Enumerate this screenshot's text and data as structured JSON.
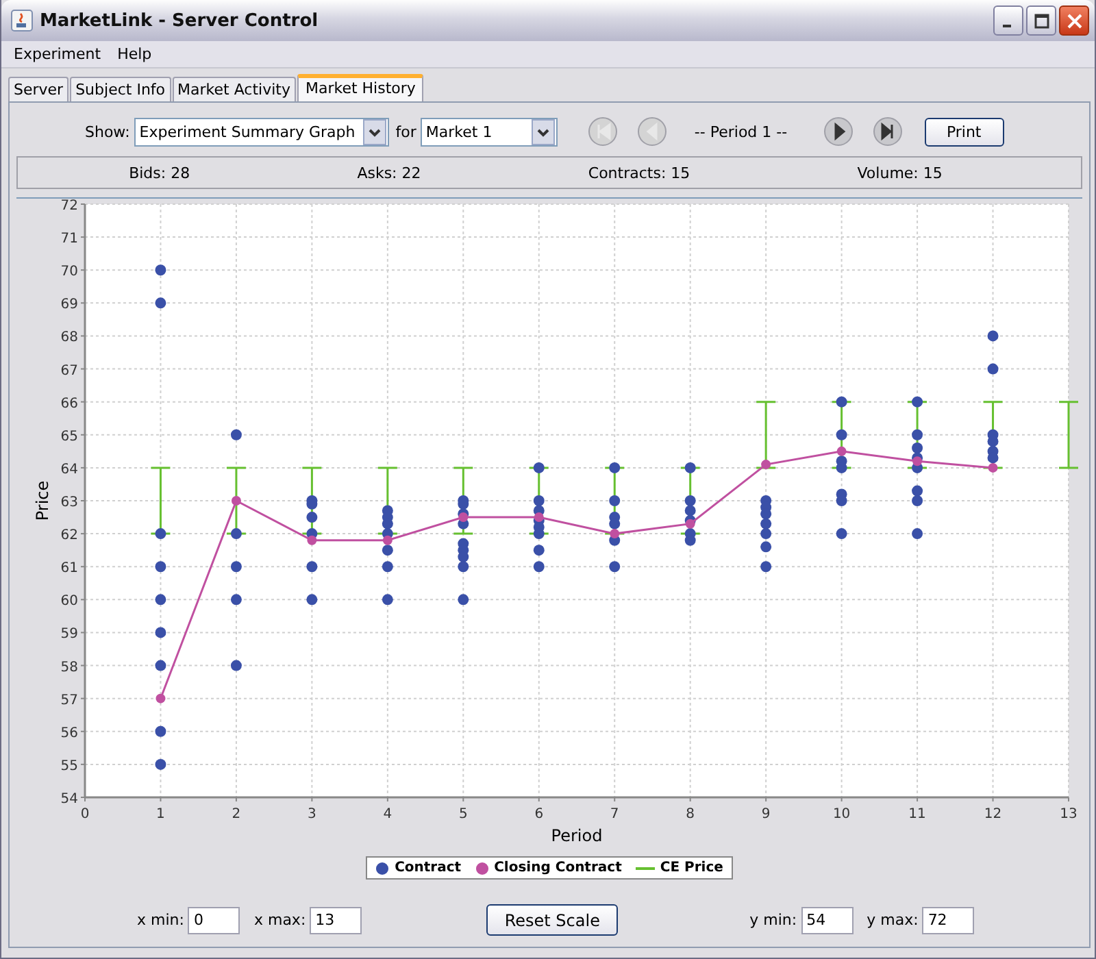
{
  "window": {
    "title": "MarketLink - Server Control"
  },
  "menu": [
    {
      "label": "Experiment"
    },
    {
      "label": "Help"
    }
  ],
  "tabs": [
    {
      "label": "Server",
      "selected": false
    },
    {
      "label": "Subject Info",
      "selected": false
    },
    {
      "label": "Market Activity",
      "selected": false
    },
    {
      "label": "Market History",
      "selected": true
    }
  ],
  "toolbar": {
    "show_label": "Show:",
    "show_select": "Experiment Summary Graph",
    "for_label": "for",
    "market_select": "Market 1",
    "nav_before": [
      {
        "kind": "first",
        "disabled": true
      },
      {
        "kind": "prev",
        "disabled": true
      }
    ],
    "period_label": "-- Period 1 --",
    "nav_after": [
      {
        "kind": "next",
        "disabled": false
      },
      {
        "kind": "last",
        "disabled": false
      }
    ],
    "print_button": {
      "label": "Print"
    }
  },
  "stats": [
    "Bids: 28",
    "Asks: 22",
    "Contracts: 15",
    "Volume: 15"
  ],
  "chart": {
    "chart_data": {
      "type": "scatter",
      "grid": true,
      "legend": "bottom",
      "xlabel": "Period",
      "ylabel": "Price",
      "xlim": [
        0,
        13
      ],
      "ylim": [
        54,
        72
      ],
      "xticks": [
        0,
        1,
        2,
        3,
        4,
        5,
        6,
        7,
        8,
        9,
        10,
        11,
        12,
        13
      ],
      "yticks": [
        54,
        55,
        56,
        57,
        58,
        59,
        60,
        61,
        62,
        63,
        64,
        65,
        66,
        67,
        68,
        69,
        70,
        71,
        72
      ],
      "series": [
        {
          "name": "Contract",
          "color": "#3a50a8",
          "marker": "circle",
          "x": [
            1,
            1,
            1,
            1,
            1,
            1,
            1,
            1,
            1,
            2,
            2,
            2,
            2,
            2,
            3,
            3,
            3,
            3,
            3,
            3,
            4,
            4,
            4,
            4,
            4,
            4,
            4,
            5,
            5,
            5,
            5,
            5,
            5,
            5,
            5,
            5,
            6,
            6,
            6,
            6,
            6,
            6,
            6,
            6,
            7,
            7,
            7,
            7,
            7,
            7,
            8,
            8,
            8,
            8,
            8,
            8,
            9,
            9,
            9,
            9,
            9,
            9,
            9,
            10,
            10,
            10,
            10,
            10,
            10,
            10,
            11,
            11,
            11,
            11,
            11,
            11,
            11,
            11,
            12,
            12,
            12,
            12,
            12,
            12
          ],
          "values": [
            70,
            69,
            62,
            61,
            60,
            59,
            58,
            56,
            55,
            65,
            62,
            61,
            60,
            58,
            63,
            62.9,
            62.5,
            62,
            61,
            60,
            62.7,
            62.5,
            62.3,
            62,
            61.5,
            61,
            60,
            63,
            62.9,
            62.6,
            62.3,
            61.7,
            61.5,
            61.3,
            61,
            60,
            64,
            63,
            62.7,
            62.4,
            62.2,
            62,
            61.5,
            61,
            64,
            63,
            62.5,
            62.3,
            61.8,
            61,
            64,
            63,
            62.7,
            62.4,
            62,
            61.8,
            63,
            62.8,
            62.6,
            62.3,
            62,
            61.6,
            61,
            66,
            65,
            64.2,
            64,
            63.2,
            63,
            62,
            66,
            65,
            64.6,
            64.3,
            64,
            63.3,
            63,
            62,
            68,
            67,
            65,
            64.8,
            64.5,
            64.3
          ]
        },
        {
          "name": "Closing Contract",
          "color": "#c050a0",
          "type": "line",
          "marker": "circle",
          "x": [
            1,
            2,
            3,
            4,
            5,
            6,
            7,
            8,
            9,
            10,
            11,
            12
          ],
          "values": [
            57,
            63,
            61.8,
            61.8,
            62.5,
            62.5,
            62,
            62.3,
            64.1,
            64.5,
            64.2,
            64
          ]
        },
        {
          "name": "CE Price",
          "color": "#66c030",
          "type": "line",
          "x": [
            1,
            1,
            null,
            2,
            2,
            null,
            3,
            3,
            null,
            4,
            4,
            null,
            5,
            5,
            null,
            6,
            6,
            null,
            7,
            7,
            null,
            8,
            8,
            null,
            9,
            9,
            null,
            10,
            10,
            null,
            11,
            11,
            null,
            12,
            12,
            null,
            13,
            13
          ],
          "values": [
            62,
            64,
            null,
            62,
            64,
            null,
            62,
            64,
            null,
            62,
            64,
            null,
            62,
            64,
            null,
            62,
            64,
            null,
            62,
            64,
            null,
            62,
            64,
            null,
            64,
            66,
            null,
            64,
            66,
            null,
            64,
            66,
            null,
            64,
            66,
            null,
            64,
            66
          ]
        }
      ]
    },
    "legend": [
      {
        "kind": "dot"
      },
      {
        "kind": "dot"
      },
      {
        "kind": "line"
      }
    ]
  },
  "scale": {
    "x_min": {
      "label": "x min:",
      "value": "0"
    },
    "x_max": {
      "label": "x max:",
      "value": "13"
    },
    "reset_button": {
      "label": "Reset Scale"
    },
    "y_min": {
      "label": "y min:",
      "value": "54"
    },
    "y_max": {
      "label": "y max:",
      "value": "72"
    }
  }
}
